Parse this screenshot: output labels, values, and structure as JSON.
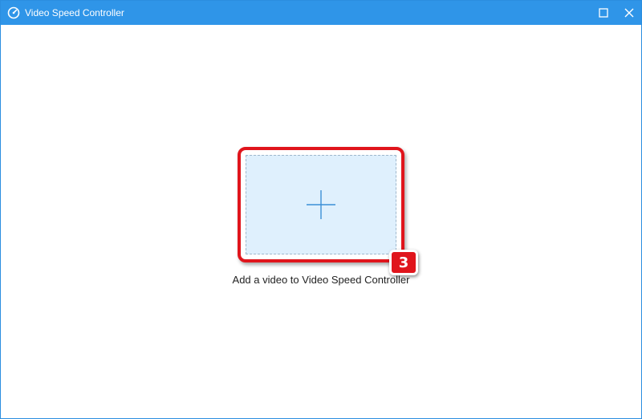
{
  "window": {
    "title": "Video Speed Controller",
    "accent_color": "#2f95e8",
    "icons": {
      "app": "speedometer-icon",
      "maximize": "maximize-icon",
      "close": "close-icon"
    }
  },
  "main": {
    "drop_zone": {
      "icon": "plus-icon",
      "caption": "Add a video to Video Speed Controller",
      "background_color": "#dff0fd"
    },
    "annotation": {
      "step_number": "3",
      "highlight_color": "#e0151c"
    }
  }
}
